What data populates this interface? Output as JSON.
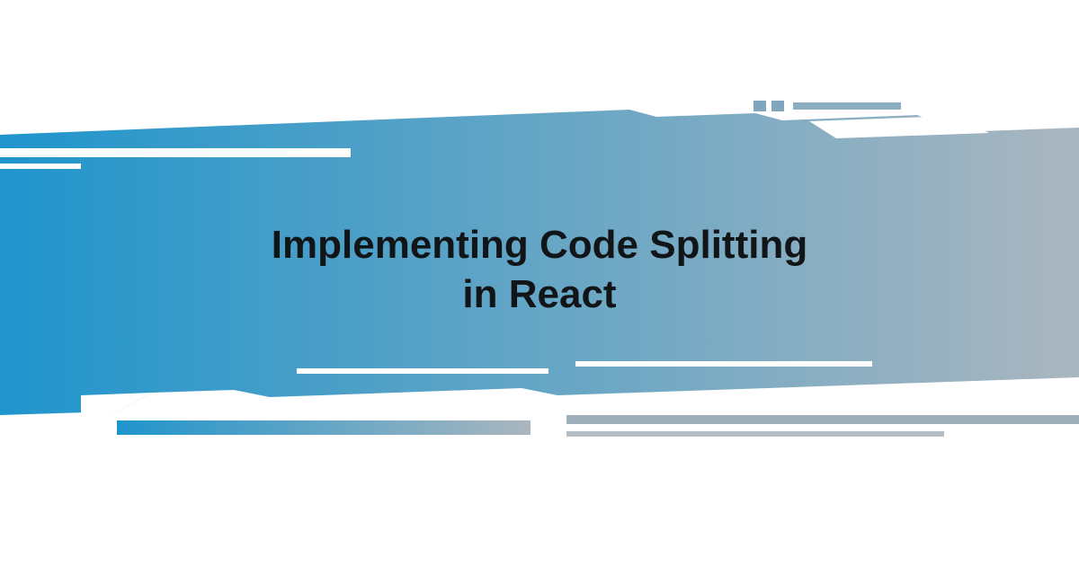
{
  "banner": {
    "title_line1": "Implementing Code Splitting",
    "title_line2": "in React",
    "colors": {
      "gradient_start": "#1f95cc",
      "gradient_end": "#aab6bf",
      "text": "#121517"
    }
  }
}
